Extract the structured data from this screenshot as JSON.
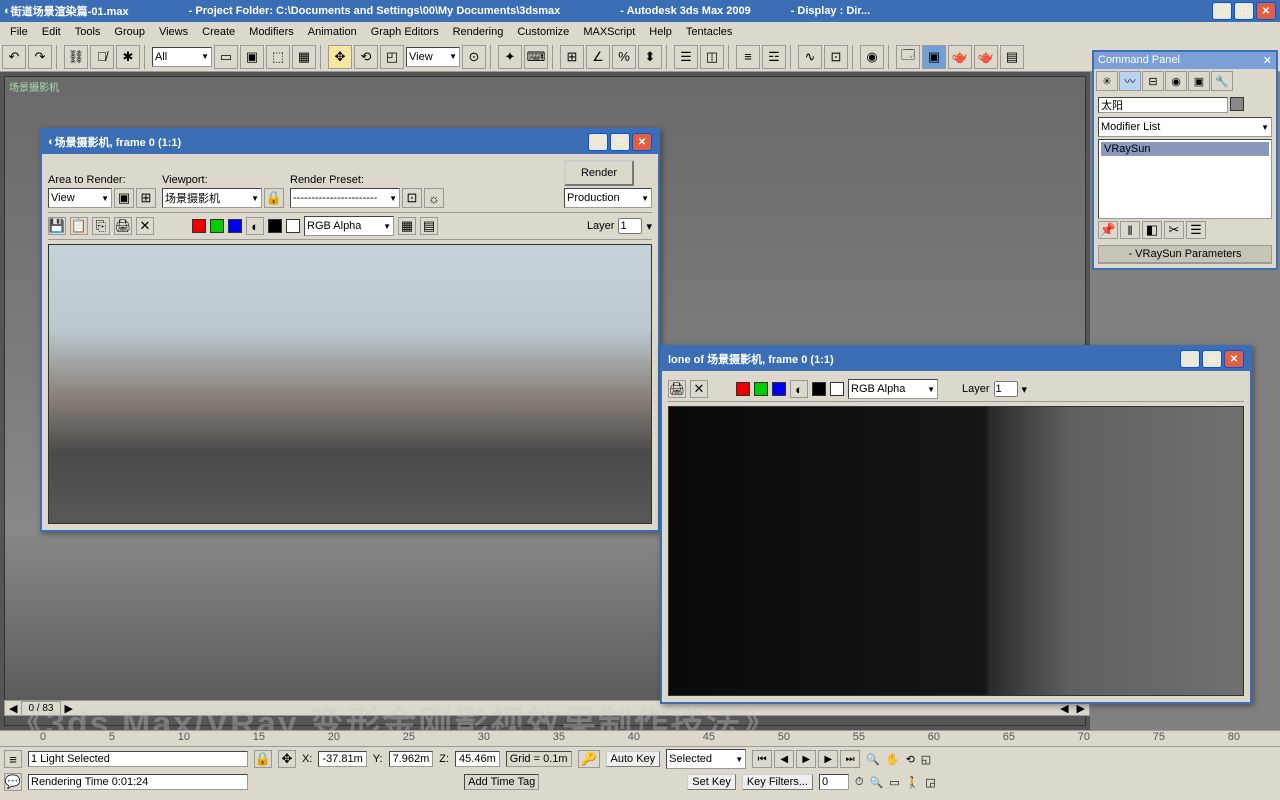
{
  "title": {
    "file": "街道场景渲染篇-01.max",
    "folder": "- Project Folder: C:\\Documents and Settings\\00\\My Documents\\3dsmax",
    "app": "- Autodesk 3ds Max  2009",
    "display": "- Display : Dir..."
  },
  "menu": [
    "File",
    "Edit",
    "Tools",
    "Group",
    "Views",
    "Create",
    "Modifiers",
    "Animation",
    "Graph Editors",
    "Rendering",
    "Customize",
    "MAXScript",
    "Help",
    "Tentacles"
  ],
  "toolbar": {
    "filter": "All",
    "refcoord": "View"
  },
  "viewport": {
    "label": "场景摄影机"
  },
  "cmdpanel": {
    "title": "Command Panel",
    "objname": "太阳",
    "modlist_label": "Modifier List",
    "stack_item": "VRaySun",
    "rollout": "VRaySun Parameters"
  },
  "dialog1": {
    "title": "场景摄影机, frame 0 (1:1)",
    "area_label": "Area to Render:",
    "area_value": "View",
    "viewport_label": "Viewport:",
    "viewport_value": "场景摄影机",
    "preset_label": "Render Preset:",
    "preset_value": "-----------------------",
    "render_btn": "Render",
    "production": "Production",
    "channel": "RGB Alpha",
    "layer_label": "Layer",
    "layer_value": "1"
  },
  "dialog2": {
    "title": "lone of 场景摄影机, frame 0 (1:1)",
    "channel": "RGB Alpha",
    "layer_label": "Layer",
    "layer_value": "1"
  },
  "timeline": {
    "frame": "0 / 83",
    "ticks": [
      "0",
      "5",
      "10",
      "15",
      "20",
      "25",
      "30",
      "35",
      "40",
      "45",
      "50",
      "55",
      "60",
      "65",
      "70",
      "75",
      "80"
    ]
  },
  "status": {
    "selection": "1 Light Selected",
    "x": "-37.81m",
    "y": "7.962m",
    "z": "45.46m",
    "grid": "Grid = 0.1m",
    "addtag": "Add Time Tag",
    "rendering": "Rendering Time 0:01:24",
    "autokey": "Auto Key",
    "setkey": "Set Key",
    "keysel": "Selected",
    "keyfilters": "Key Filters..."
  },
  "watermark": "《3ds Max/VRay 变形金刚影视效果制作技法》"
}
